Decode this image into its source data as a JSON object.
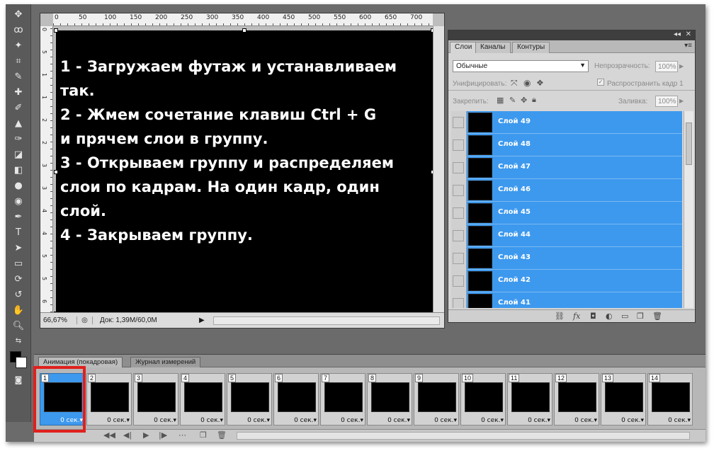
{
  "document": {
    "ruler_top": [
      "0",
      "50",
      "100",
      "150",
      "200",
      "250",
      "300",
      "350",
      "400",
      "450",
      "500",
      "550",
      "600",
      "650",
      "700"
    ],
    "ruler_left": [
      "0",
      "5",
      "1",
      "1",
      "2",
      "2",
      "3",
      "3",
      "4",
      "4",
      "5",
      "5",
      "6"
    ],
    "canvas_lines": [
      "1 -  Загружаем футаж и устанавливаем",
      "так.",
      "2 - Жмем сочетание клавиш Ctrl + G",
      "и прячем слои в группу.",
      "3 - Открываем группу и распределяем",
      "слои по кадрам. На один кадр, один",
      "слой.",
      "4 - Закрываем группу."
    ],
    "zoom": "66,67%",
    "doc_size": "Док: 1,39M/60,0M",
    "canvas_color": "#000000"
  },
  "layers_panel": {
    "tabs": [
      "Слои",
      "Каналы",
      "Контуры"
    ],
    "active_tab": "Слои",
    "blend_mode": "Обычные",
    "opacity_label": "Непрозрачность:",
    "opacity_value": "100%",
    "unify_label": "Унифицировать:",
    "propagate_label": "Распространить кадр 1",
    "lock_label": "Закрепить:",
    "fill_label": "Заливка:",
    "fill_value": "100%",
    "layers": [
      "Слой 49",
      "Слой 48",
      "Слой 47",
      "Слой 46",
      "Слой 45",
      "Слой 44",
      "Слой 43",
      "Слой 42",
      "Слой 41"
    ],
    "selected_color": "#3d99ee"
  },
  "animation_panel": {
    "tabs": [
      "Анимация (покадровая)",
      "Журнал измерений"
    ],
    "frames": [
      {
        "num": "1",
        "delay": "0 сек."
      },
      {
        "num": "2",
        "delay": "0 сек."
      },
      {
        "num": "3",
        "delay": "0 сек."
      },
      {
        "num": "4",
        "delay": "0 сек."
      },
      {
        "num": "5",
        "delay": "0 сек."
      },
      {
        "num": "6",
        "delay": "0 сек."
      },
      {
        "num": "7",
        "delay": "0 сек."
      },
      {
        "num": "8",
        "delay": "0 сек."
      },
      {
        "num": "9",
        "delay": "0 сек."
      },
      {
        "num": "10",
        "delay": "0 сек."
      },
      {
        "num": "11",
        "delay": "0 сек."
      },
      {
        "num": "12",
        "delay": "0 сек."
      },
      {
        "num": "13",
        "delay": "0 сек."
      },
      {
        "num": "14",
        "delay": "0 сек."
      }
    ],
    "selected_frame": "1",
    "highlight_color": "#e0201d"
  },
  "icons": {
    "toolbox": [
      "move-icon",
      "lasso-icon",
      "magic-wand-icon",
      "crop-icon",
      "eyedropper-icon",
      "healing-brush-icon",
      "brush-icon",
      "clone-stamp-icon",
      "history-brush-icon",
      "eraser-icon",
      "gradient-icon",
      "blur-icon",
      "dodge-icon",
      "pen-icon",
      "type-icon",
      "path-selection-icon",
      "rectangle-icon",
      "3d-rotate-icon",
      "3d-orbit-icon",
      "hand-icon",
      "zoom-icon"
    ]
  }
}
